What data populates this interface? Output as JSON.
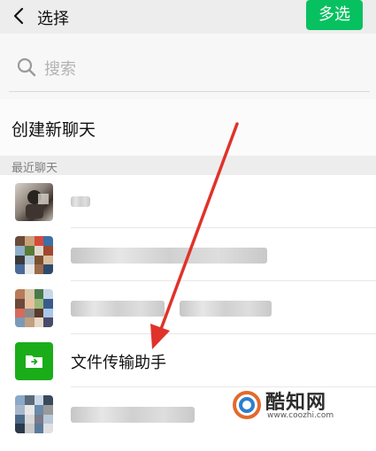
{
  "header": {
    "title": "选择",
    "multi_select_label": "多选"
  },
  "search": {
    "placeholder": "搜索"
  },
  "new_chat": {
    "label": "创建新聊天"
  },
  "recent_section": {
    "label": "最近聊天"
  },
  "chats": [
    {
      "name": "",
      "avatar": "photo-avatar",
      "redacted": true
    },
    {
      "name": "",
      "avatar": "group-avatar",
      "redacted": true
    },
    {
      "name": "",
      "avatar": "group-avatar",
      "redacted": true
    },
    {
      "name": "文件传输助手",
      "avatar": "folder-icon",
      "redacted": false
    },
    {
      "name": "",
      "avatar": "group-avatar",
      "redacted": true
    }
  ],
  "watermark": {
    "name": "酷知网",
    "url": "www.coozhi.com"
  },
  "colors": {
    "accent": "#07c160",
    "folder_green": "#1aad19",
    "arrow_red": "#e0322a"
  }
}
